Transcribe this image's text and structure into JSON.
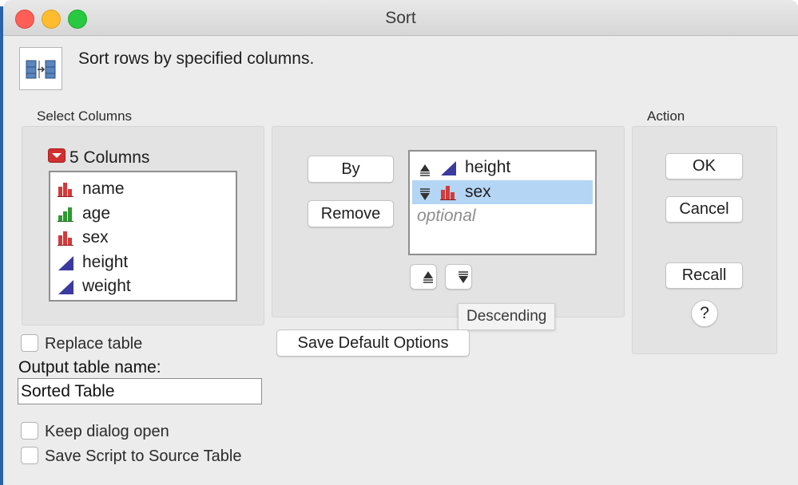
{
  "window": {
    "title": "Sort"
  },
  "header": {
    "description": "Sort rows by specified columns.",
    "icon": "sort-columns-icon"
  },
  "select_columns": {
    "label": "Select Columns",
    "count_label": "5 Columns",
    "columns": [
      {
        "name": "name",
        "type": "nominal-icon",
        "color": "#d33a3a"
      },
      {
        "name": "age",
        "type": "ordinal-icon",
        "color": "#2f9a2f"
      },
      {
        "name": "sex",
        "type": "nominal-icon",
        "color": "#d33a3a"
      },
      {
        "name": "height",
        "type": "continuous-icon",
        "color": "#3b3a9e"
      },
      {
        "name": "weight",
        "type": "continuous-icon",
        "color": "#3b3a9e"
      }
    ]
  },
  "sort_by": {
    "by_label": "By",
    "remove_label": "Remove",
    "items": [
      {
        "name": "height",
        "order_icon": "ascending-icon",
        "type": "continuous-icon"
      },
      {
        "name": "sex",
        "order_icon": "descending-icon",
        "type": "nominal-icon",
        "selected": true
      }
    ],
    "placeholder": "optional",
    "tooltip": "Descending"
  },
  "action": {
    "label": "Action",
    "ok_label": "OK",
    "cancel_label": "Cancel",
    "recall_label": "Recall",
    "help_label": "?"
  },
  "options": {
    "replace_table": "Replace table",
    "output_name_label": "Output table name:",
    "output_name_value": "Sorted Table",
    "keep_open": "Keep dialog open",
    "save_script": "Save Script to Source Table",
    "save_defaults": "Save Default Options"
  },
  "colors": {
    "accent_selected": "#b5d5f5",
    "nominal": "#d33a3a",
    "ordinal": "#2f9a2f",
    "continuous": "#3b3a9e"
  }
}
